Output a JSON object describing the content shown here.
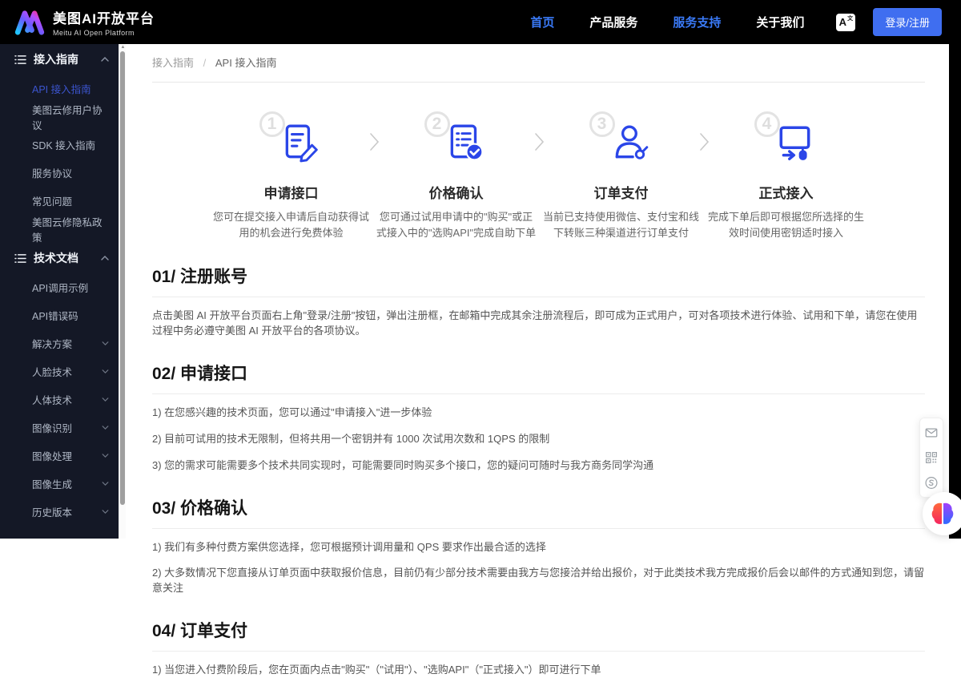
{
  "colors": {
    "header_bg": "#000000",
    "nav_active_blue": "#3a7af7",
    "login_button_blue": "#3f6ef0",
    "sidebar_bg": "#141826",
    "sidebar_active_blue": "#3c55cf",
    "step_icon_blue": "#2b46e8"
  },
  "header": {
    "logo": {
      "title": "美图AI开放平台",
      "subtitle": "Meitu AI Open Platform"
    },
    "nav": [
      {
        "label": "首页",
        "active": true
      },
      {
        "label": "产品服务",
        "active": false
      },
      {
        "label": "服务支持",
        "active": true
      },
      {
        "label": "关于我们",
        "active": false
      }
    ],
    "language": {
      "main": "A",
      "sup": "文"
    },
    "login_button": "登录/注册"
  },
  "sidebar": {
    "sections": [
      {
        "label": "接入指南",
        "expanded": true,
        "items": [
          {
            "label": "API 接入指南",
            "active": true,
            "expandable": false
          },
          {
            "label": "美图云修用户协议",
            "active": false,
            "expandable": false
          },
          {
            "label": "SDK 接入指南",
            "active": false,
            "expandable": false
          },
          {
            "label": "服务协议",
            "active": false,
            "expandable": false
          },
          {
            "label": "常见问题",
            "active": false,
            "expandable": false
          },
          {
            "label": "美图云修隐私政策",
            "active": false,
            "expandable": false
          }
        ]
      },
      {
        "label": "技术文档",
        "expanded": true,
        "items": [
          {
            "label": "API调用示例",
            "active": false,
            "expandable": false
          },
          {
            "label": "API错误码",
            "active": false,
            "expandable": false
          },
          {
            "label": "解决方案",
            "active": false,
            "expandable": true
          },
          {
            "label": "人脸技术",
            "active": false,
            "expandable": true
          },
          {
            "label": "人体技术",
            "active": false,
            "expandable": true
          },
          {
            "label": "图像识别",
            "active": false,
            "expandable": true
          },
          {
            "label": "图像处理",
            "active": false,
            "expandable": true
          },
          {
            "label": "图像生成",
            "active": false,
            "expandable": true
          },
          {
            "label": "历史版本",
            "active": false,
            "expandable": true
          }
        ]
      }
    ]
  },
  "breadcrumb": {
    "parent": "接入指南",
    "separator": "/",
    "current": "API 接入指南"
  },
  "steps": [
    {
      "num": "1",
      "title": "申请接口",
      "icon": "doc-pencil-icon",
      "desc": "您可在提交接入申请后自动获得试用的机会进行免费体验"
    },
    {
      "num": "2",
      "title": "价格确认",
      "icon": "doc-check-icon",
      "desc": "您可通过试用申请中的\"购买\"或正式接入中的\"选购API\"完成自助下单"
    },
    {
      "num": "3",
      "title": "订单支付",
      "icon": "user-key-icon",
      "desc": "当前已支持使用微信、支付宝和线下转账三种渠道进行订单支付"
    },
    {
      "num": "4",
      "title": "正式接入",
      "icon": "monitor-arrow-icon",
      "desc": "完成下单后即可根据您所选择的生效时间使用密钥适时接入"
    }
  ],
  "sections": [
    {
      "heading": "01/ 注册账号",
      "lines": [
        "点击美图 AI 开放平台页面右上角\"登录/注册\"按钮，弹出注册框，在邮箱中完成其余注册流程后，即可成为正式用户，可对各项技术进行体验、试用和下单，请您在使用过程中务必遵守美图 AI 开放平台的各项协议。"
      ]
    },
    {
      "heading": "02/ 申请接口",
      "lines": [
        "1) 在您感兴趣的技术页面，您可以通过\"申请接入\"进一步体验",
        "2) 目前可试用的技术无限制，但将共用一个密钥并有 1000 次试用次数和 1QPS 的限制",
        "3) 您的需求可能需要多个技术共同实现时，可能需要同时购买多个接口，您的疑问可随时与我方商务同学沟通"
      ]
    },
    {
      "heading": "03/ 价格确认",
      "lines": [
        "1) 我们有多种付费方案供您选择，您可根据预计调用量和 QPS 要求作出最合适的选择",
        "2) 大多数情况下您直接从订单页面中获取报价信息，目前仍有少部分技术需要由我方与您接洽并给出报价，对于此类技术我方完成报价后会以邮件的方式通知到您，请留意关注"
      ]
    },
    {
      "heading": "04/ 订单支付",
      "lines": [
        "1) 当您进入付费阶段后，您在页面内点击\"购买\"（\"试用\"）、\"选购API\"（\"正式接入\"）即可进行下单"
      ]
    }
  ],
  "floating": {
    "icons": [
      {
        "name": "mail-icon"
      },
      {
        "name": "qr-code-icon"
      },
      {
        "name": "phone-icon"
      }
    ]
  }
}
